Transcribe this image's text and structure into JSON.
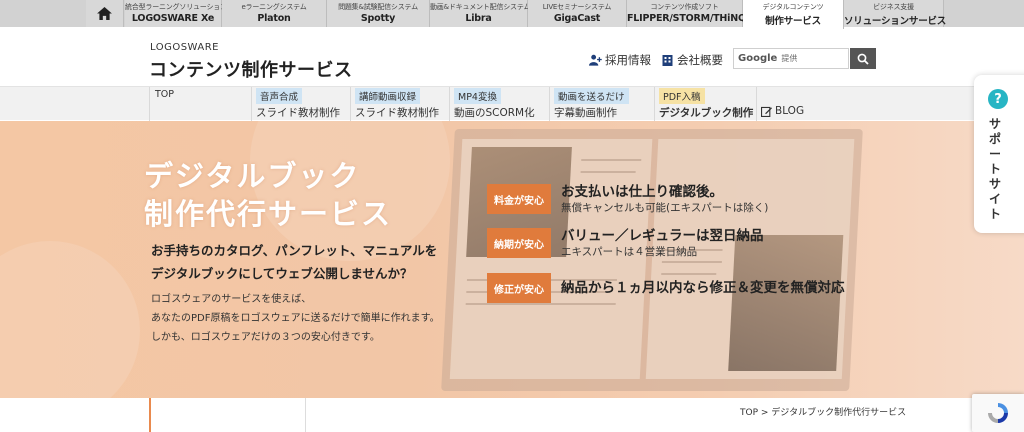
{
  "products": {
    "home_label": "home",
    "tabs": [
      {
        "sub": "統合型ラーニングソリューション",
        "name": "LOGOSWARE Xe"
      },
      {
        "sub": "eラーニングシステム",
        "name": "Platon"
      },
      {
        "sub": "問題集&試験配信システム",
        "name": "Spotty"
      },
      {
        "sub": "動画&ドキュメント配信システム",
        "name": "Libra"
      },
      {
        "sub": "LIVEセミナーシステム",
        "name": "GigaCast"
      },
      {
        "sub": "コンテンツ作成ソフト",
        "name": "FLIPPER/STORM/THiNQ"
      },
      {
        "sub": "デジタルコンテンツ",
        "name": "制作サービス"
      },
      {
        "sub": "ビジネス支援",
        "name": "ソリューションサービス"
      }
    ]
  },
  "header": {
    "brand_small": "LOGOSWARE",
    "brand_big": "コンテンツ制作サービス",
    "recruit_label": "採用情報",
    "company_label": "会社概要",
    "search_logo": "Google",
    "search_placeholder": "提供"
  },
  "service_nav": {
    "top_label": "TOP",
    "items": [
      {
        "tag": "音声合成",
        "label": "スライド教材制作"
      },
      {
        "tag": "講師動画収録",
        "label": "スライド教材制作"
      },
      {
        "tag": "MP4変換",
        "label": "動画のSCORM化"
      },
      {
        "tag": "動画を送るだけ",
        "label": "字幕動画制作"
      },
      {
        "tag": "PDF入稿",
        "label": "デジタルブック制作"
      }
    ],
    "blog_label": "BLOG"
  },
  "hero": {
    "title_line1": "デジタルブック",
    "title_line2": "制作代行サービス",
    "lead_line1": "お手持ちのカタログ、パンフレット、マニュアルを",
    "lead_line2": "デジタルブックにしてウェブ公開しませんか？",
    "body_line1": "ロゴスウェアのサービスを使えば、",
    "body_line2": "あなたのPDF原稿をロゴスウェアに送るだけで簡単に作れます。",
    "body_line3": "しかも、ロゴスウェアだけの３つの安心付きです。",
    "promises": [
      {
        "badge": "料金が安心",
        "main": "お支払いは仕上り確認後。",
        "note": "無償キャンセルも可能(エキスパートは除く)"
      },
      {
        "badge": "納期が安心",
        "main": "バリュー／レギュラーは翌日納品",
        "note": "エキスパートは４営業日納品"
      },
      {
        "badge": "修正が安心",
        "main": "納品から１ヵ月以内なら修正＆変更を無償対応",
        "note": ""
      }
    ]
  },
  "support": {
    "label": "サポートサイト",
    "icon": "?"
  },
  "breadcrumb": {
    "text": "TOP > デジタルブック制作代行サービス"
  }
}
